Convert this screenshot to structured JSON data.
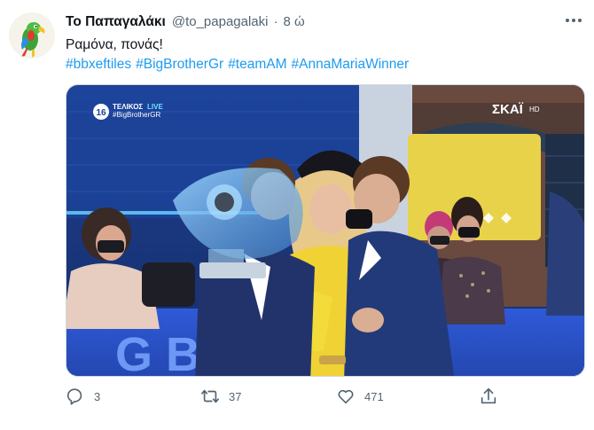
{
  "tweet": {
    "author_name": "Το Παπαγαλάκι",
    "author_handle": "@to_papagalaki",
    "separator": "·",
    "time": "8 ώ",
    "text": "Ραμόνα, πονάς!",
    "hashtags": [
      "#bbxeftiles",
      "#BigBrotherGr",
      "#teamAM",
      "#AnnaMariaWinner"
    ]
  },
  "media": {
    "overlay_line1": "ΤΕΛΙΚΟΣ",
    "overlay_live": "LIVE",
    "overlay_line2": "#BigBrotherGR",
    "channel_badge": "16",
    "channel_logo": "ΣΚΑΪ",
    "channel_hd": "HD",
    "backdrop_letters": "G B  R  R"
  },
  "actions": {
    "replies": "3",
    "retweets": "37",
    "likes": "471"
  },
  "colors": {
    "link": "#1d9bf0",
    "secondary": "#536471",
    "primary": "#0f1419"
  }
}
